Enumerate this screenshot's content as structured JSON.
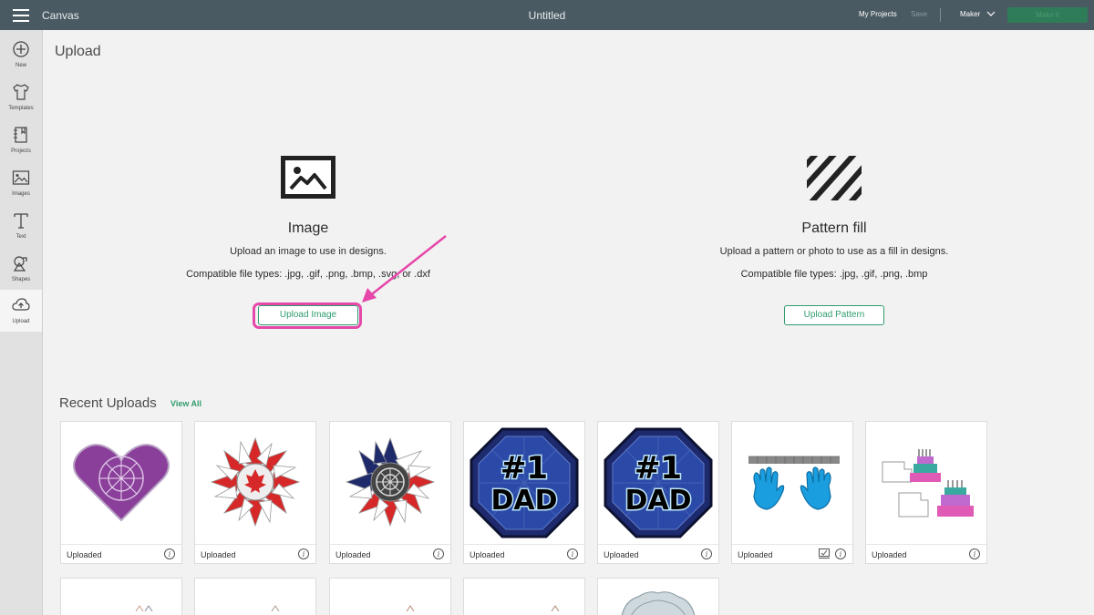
{
  "topbar": {
    "app_name": "Canvas",
    "document_title": "Untitled",
    "my_projects": "My Projects",
    "save": "Save",
    "machine": "Maker",
    "make_it": "Make it"
  },
  "sidebar": {
    "items": [
      {
        "label": "New",
        "icon": "plus-circle-icon"
      },
      {
        "label": "Templates",
        "icon": "shirt-icon"
      },
      {
        "label": "Projects",
        "icon": "notebook-icon"
      },
      {
        "label": "Images",
        "icon": "image-icon"
      },
      {
        "label": "Text",
        "icon": "text-icon"
      },
      {
        "label": "Shapes",
        "icon": "shapes-icon"
      },
      {
        "label": "Upload",
        "icon": "cloud-upload-icon",
        "active": true
      }
    ]
  },
  "main": {
    "page_title": "Upload",
    "image_section": {
      "title": "Image",
      "description": "Upload an image to use in designs.",
      "file_types": "Compatible file types: .jpg, .gif, .png, .bmp, .svg, or .dxf",
      "button": "Upload Image"
    },
    "pattern_section": {
      "title": "Pattern fill",
      "description": "Upload a pattern or photo to use as a fill in designs.",
      "file_types": "Compatible file types: .jpg, .gif, .png, .bmp",
      "button": "Upload Pattern"
    },
    "recent": {
      "title": "Recent Uploads",
      "view_all": "View All",
      "cards": [
        {
          "label": "Uploaded",
          "thumb": "purple-mandala-heart"
        },
        {
          "label": "Uploaded",
          "thumb": "canada-maple-leaf-flower"
        },
        {
          "label": "Uploaded",
          "thumb": "usa-flag-flower"
        },
        {
          "label": "Uploaded",
          "thumb": "number-one-dad-badge"
        },
        {
          "label": "Uploaded",
          "thumb": "number-one-dad-badge"
        },
        {
          "label": "Uploaded",
          "thumb": "blue-hands",
          "has_check": true
        },
        {
          "label": "Uploaded",
          "thumb": "birthday-cakes"
        }
      ]
    }
  },
  "colors": {
    "topbar": "#4a5a62",
    "accent_green": "#2f9c6d",
    "highlight_pink": "#e548a9"
  }
}
